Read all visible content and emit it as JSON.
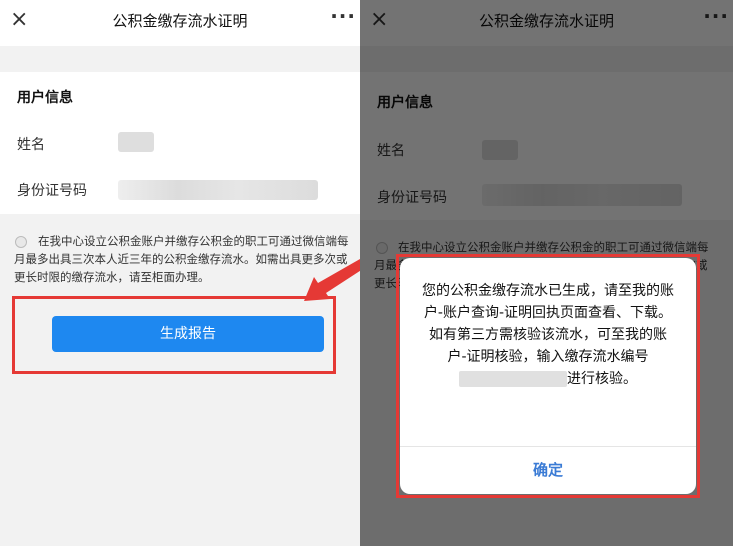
{
  "page": {
    "title": "公积金缴存流水证明",
    "close_icon": "×",
    "more_icon": "···"
  },
  "user_info": {
    "section_title": "用户信息",
    "name_label": "姓名",
    "id_label": "身份证号码"
  },
  "notice": {
    "text": "在我中心设立公积金账户并缴存公积金的职工可通过微信端每月最多出具三次本人近三年的公积金缴存流水。如需出具更多次或更长时限的缴存流水，请至柜面办理。"
  },
  "generate_button": {
    "label": "生成报告"
  },
  "dialog": {
    "message_pre": "您的公积金缴存流水已生成，请至我的账户-账户查询-证明回执页面查看、下载。如有第三方需核验该流水，可至我的账户-证明核验，输入缴存流水编号",
    "message_post": "进行核验。",
    "confirm_label": "确定"
  },
  "colors": {
    "primary": "#1e88f0",
    "highlight": "#e53935",
    "confirm_text": "#3a7bd5"
  }
}
